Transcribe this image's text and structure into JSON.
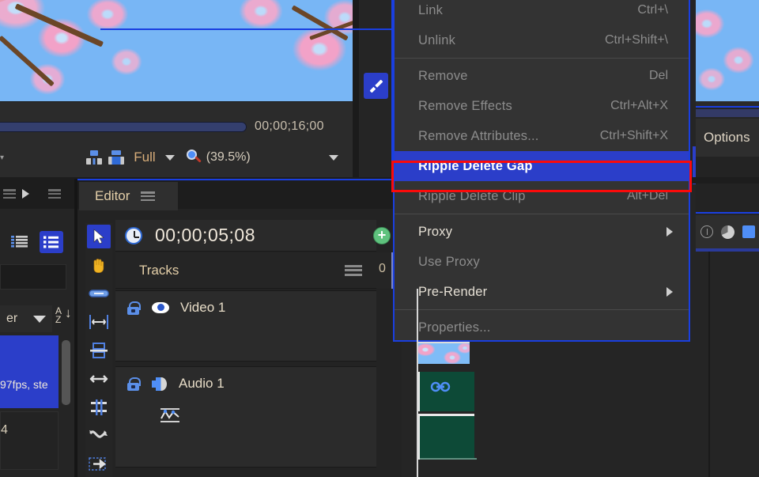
{
  "app": {
    "preview": {
      "timecode_total": "00;00;16;00",
      "quality_label": "Full",
      "zoom_level": "(39.5%)",
      "icons": [
        "safe-margin-icon",
        "safe-title-icon",
        "magnifier-icon",
        "dropdown-caret-icon"
      ]
    }
  },
  "context_menu": {
    "items": [
      {
        "label": "Link",
        "shortcut": "Ctrl+\\",
        "enabled": false,
        "submenu": false,
        "highlighted": false
      },
      {
        "label": "Unlink",
        "shortcut": "Ctrl+Shift+\\",
        "enabled": false,
        "submenu": false,
        "highlighted": false
      },
      {
        "separator": true
      },
      {
        "label": "Remove",
        "shortcut": "Del",
        "enabled": false,
        "submenu": false,
        "highlighted": false
      },
      {
        "label": "Remove Effects",
        "shortcut": "Ctrl+Alt+X",
        "enabled": false,
        "submenu": false,
        "highlighted": false
      },
      {
        "label": "Remove Attributes...",
        "shortcut": "Ctrl+Shift+X",
        "enabled": false,
        "submenu": false,
        "highlighted": false
      },
      {
        "label": "Ripple Delete Gap",
        "shortcut": "",
        "enabled": true,
        "submenu": false,
        "highlighted": true
      },
      {
        "label": "Ripple Delete Clip",
        "shortcut": "Alt+Del",
        "enabled": false,
        "submenu": false,
        "highlighted": false
      },
      {
        "separator": true
      },
      {
        "label": "Proxy",
        "shortcut": "",
        "enabled": true,
        "submenu": true,
        "highlighted": false
      },
      {
        "label": "Use Proxy",
        "shortcut": "",
        "enabled": false,
        "submenu": false,
        "highlighted": false
      },
      {
        "label": "Pre-Render",
        "shortcut": "",
        "enabled": true,
        "submenu": true,
        "highlighted": false
      },
      {
        "separator": true
      },
      {
        "label": "Properties...",
        "shortcut": "",
        "enabled": false,
        "submenu": false,
        "highlighted": false
      }
    ],
    "highlight_color": "#2b3ec9",
    "annotation_color": "#fb0a0a"
  },
  "editor": {
    "tab_label": "Editor",
    "timecode": "00;00;05;08",
    "tracks_label": "Tracks",
    "ruler_start": "0",
    "tracks": [
      {
        "name": "Video 1",
        "type": "video"
      },
      {
        "name": "Audio 1",
        "type": "audio"
      }
    ]
  },
  "right_panel": {
    "options_label": "Options"
  },
  "bin_panel": {
    "filter_label": "er",
    "selected_clip_meta": "97fps, ste",
    "second_clip_meta": "4"
  },
  "toolbar": {
    "tools": [
      {
        "name": "selection-tool",
        "selected": true
      },
      {
        "name": "hand-tool",
        "selected": false
      },
      {
        "name": "clip-tool",
        "selected": false
      },
      {
        "name": "trim-in-out-tool",
        "selected": false
      },
      {
        "name": "slip-tool",
        "selected": false
      },
      {
        "name": "slide-tool",
        "selected": false
      },
      {
        "name": "roll-tool",
        "selected": false
      },
      {
        "name": "curve-tool",
        "selected": false
      },
      {
        "name": "ripple-tool",
        "selected": false
      }
    ]
  }
}
